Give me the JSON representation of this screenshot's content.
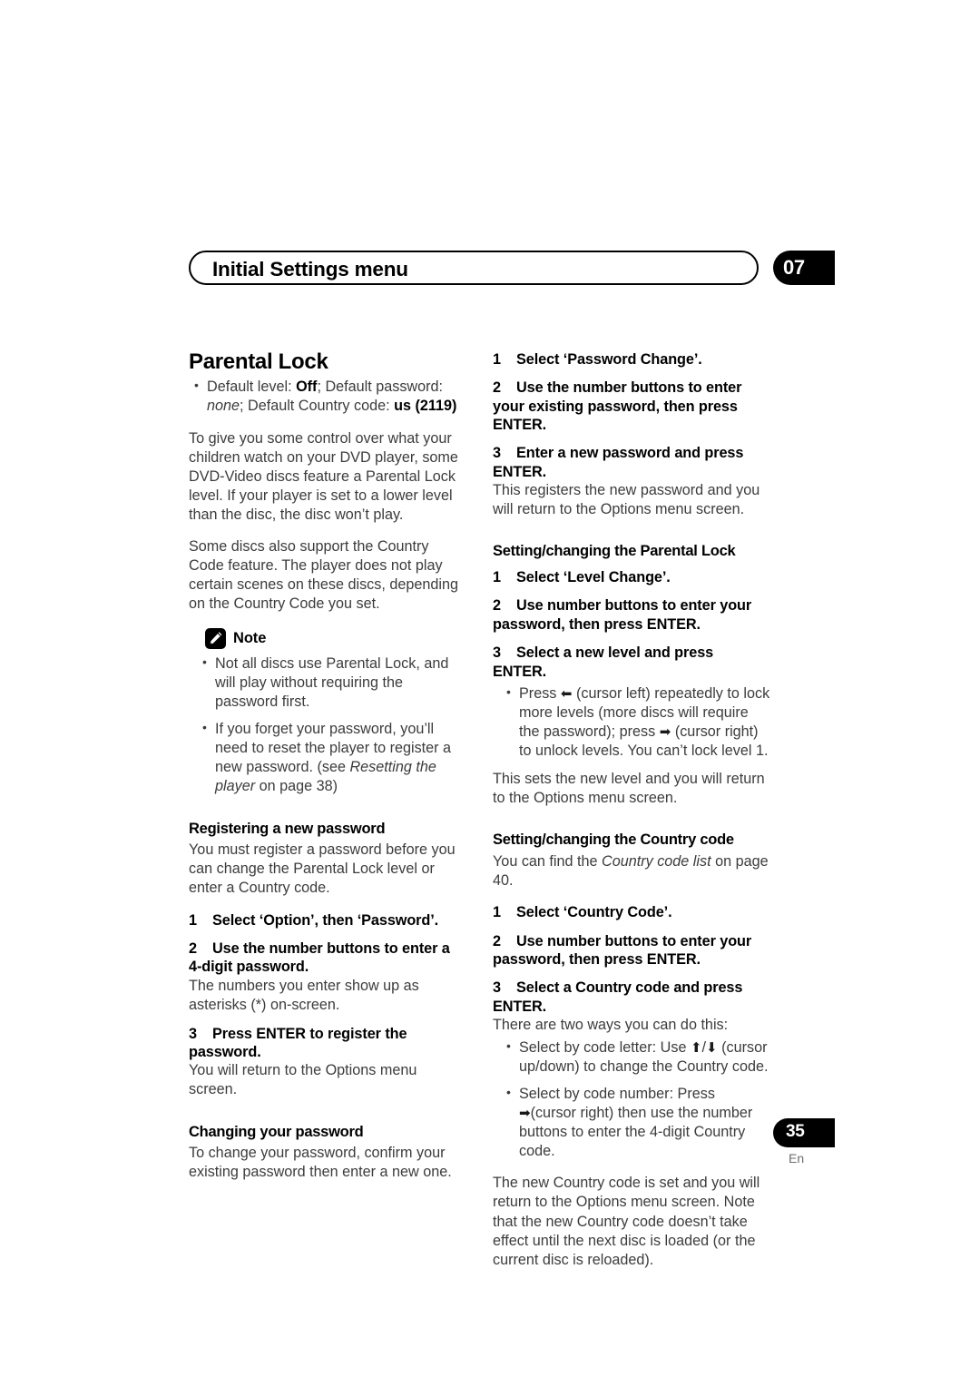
{
  "header": {
    "title": "Initial Settings menu",
    "chapter_number": "07"
  },
  "footer": {
    "page_number": "35",
    "language": "En"
  },
  "left_column": {
    "section_title": "Parental Lock",
    "defaults_bullet": {
      "prefix": "Default level: ",
      "default_level": "Off",
      "mid": "; Default password: ",
      "default_password": "none",
      "mid2": "; Default Country code: ",
      "default_country_code": "us (2119)"
    },
    "intro_paragraph": "To give you some control over what your children watch on your DVD player, some DVD-Video discs feature a Parental Lock level. If your player is set to a lower level than the disc, the disc won’t play.",
    "country_code_paragraph": "Some discs also support the Country Code feature. The player does not play certain scenes on these discs, depending on the Country Code you set.",
    "note": {
      "label": "Note",
      "icon": "pencil-note-icon",
      "bullets": [
        "Not all discs use Parental Lock, and will play without requiring the password first.",
        {
          "prefix": "If you forget your password, you’ll need to reset the player to register a new password. (see ",
          "italic": "Resetting the player",
          "suffix": " on page 38)"
        }
      ]
    },
    "registering": {
      "heading": "Registering a new password",
      "intro": "You must register a password before you can change the Parental Lock level or enter a Country code.",
      "steps": [
        {
          "num": "1",
          "text": "Select ‘Option’, then ‘Password’."
        },
        {
          "num": "2",
          "text": "Use the number buttons to enter a 4-digit password.",
          "body": "The numbers you enter show up as asterisks (*) on-screen."
        },
        {
          "num": "3",
          "text": "Press ENTER to register the password.",
          "body": "You will return to the Options menu screen."
        }
      ]
    },
    "changing": {
      "heading": "Changing your password",
      "intro": "To change your password, confirm your existing password then enter a new one."
    }
  },
  "right_column": {
    "password_change_steps": [
      {
        "num": "1",
        "text": "Select ‘Password Change’."
      },
      {
        "num": "2",
        "text": "Use the number buttons to enter your existing password, then press ENTER."
      },
      {
        "num": "3",
        "text": "Enter a new password and press ENTER.",
        "body": "This registers the new password and you will return to the Options menu screen."
      }
    ],
    "parental_lock": {
      "heading": "Setting/changing the Parental Lock",
      "steps": [
        {
          "num": "1",
          "text": "Select ‘Level Change’."
        },
        {
          "num": "2",
          "text": "Use number buttons to enter your password, then press ENTER."
        },
        {
          "num": "3",
          "text": "Select a new level and press ENTER."
        }
      ],
      "bullet": {
        "part1": "Press ",
        "arrow_left": "⬅",
        "part2": " (cursor left) repeatedly to lock more levels (more discs will require the password); press ",
        "arrow_right": "➡",
        "part3": " (cursor right) to unlock levels. You can’t lock level 1."
      },
      "closing": "This sets the new level and you will return to the Options menu screen."
    },
    "country_code": {
      "heading": "Setting/changing the Country code",
      "intro_prefix": "You can find the ",
      "intro_italic": "Country code list",
      "intro_suffix": " on page 40.",
      "steps": [
        {
          "num": "1",
          "text": "Select ‘Country Code’."
        },
        {
          "num": "2",
          "text": "Use number buttons to enter your password, then press ENTER."
        },
        {
          "num": "3",
          "text": "Select a Country code and press ENTER.",
          "body": "There are two ways you can do this:"
        }
      ],
      "bullets": {
        "by_letter": {
          "part1": "Select by code letter: Use ",
          "arrow_up": "⬆",
          "slash": "/",
          "arrow_down": "⬇",
          "part2": " (cursor up/down) to change the Country code."
        },
        "by_number": {
          "part1": "Select by code number: Press ",
          "arrow_right": "➡",
          "part2": "(cursor right) then use the number buttons to enter the 4-digit Country code."
        }
      },
      "closing": "The new Country code is set and you will return to the Options menu screen. Note that the new Country code doesn’t take effect until the next disc is loaded (or the current disc is reloaded)."
    }
  }
}
